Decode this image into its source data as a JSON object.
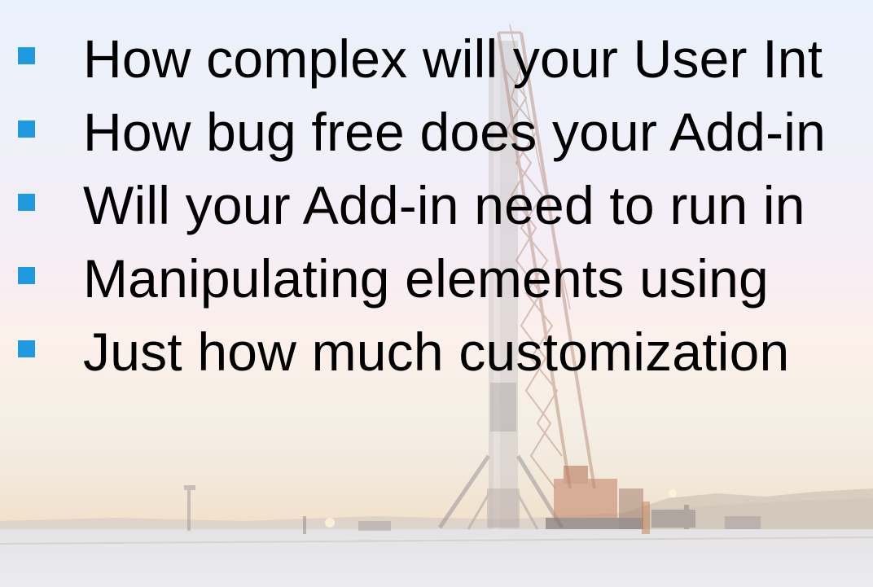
{
  "slide": {
    "bullets": [
      {
        "text": "How complex will your User Int"
      },
      {
        "text": "How bug free does your Add-in"
      },
      {
        "text": "Will your Add-in need to run in"
      },
      {
        "text": "Manipulating elements using"
      },
      {
        "text": "Just how much customization"
      }
    ]
  },
  "colors": {
    "bullet_marker": "#1f9ae0",
    "text": "#000000"
  }
}
